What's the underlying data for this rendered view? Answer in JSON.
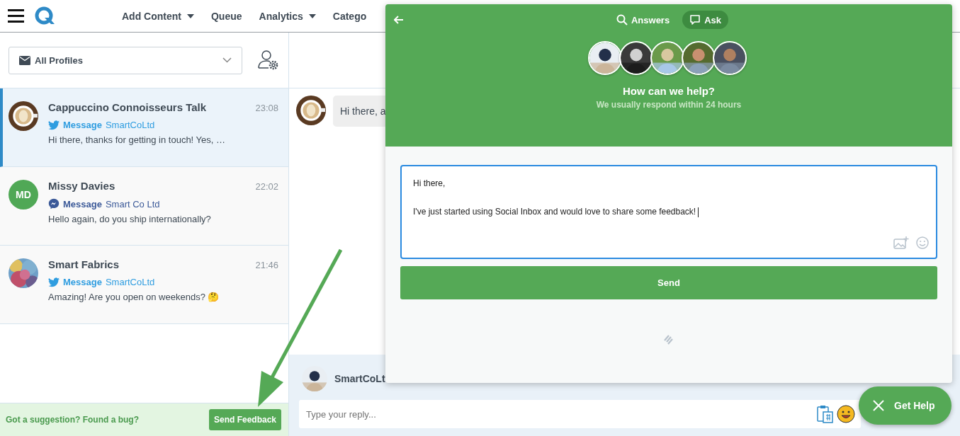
{
  "nav": {
    "items": [
      {
        "label": "Add Content",
        "dropdown": true
      },
      {
        "label": "Queue",
        "dropdown": false
      },
      {
        "label": "Analytics",
        "dropdown": true
      },
      {
        "label": "Catego",
        "dropdown": false
      }
    ]
  },
  "sidebar": {
    "profile_filter": "All Profiles",
    "conversations": [
      {
        "name": "Cappuccino Connoisseurs Talk",
        "time": "23:08",
        "kind": "twitter",
        "type": "Message",
        "account": "SmartCoLtd",
        "preview": "Hi there, thanks for getting in touch! Yes, …",
        "selected": true
      },
      {
        "name": "Missy Davies",
        "time": "22:02",
        "kind": "messenger",
        "type": "Message",
        "account": "Smart Co Ltd",
        "preview": "Hello again, do you ship internationally?",
        "avatar": {
          "kind": "initials",
          "initials": "MD"
        },
        "selected": false
      },
      {
        "name": "Smart Fabrics",
        "time": "21:46",
        "kind": "twitter",
        "type": "Message",
        "account": "SmartCoLtd",
        "preview": "Amazing! Are you open on weekends? 🤔",
        "selected": false
      }
    ],
    "footer": {
      "prompt": "Got a suggestion? Found a bug?",
      "button": "Send Feedback"
    }
  },
  "conversation": {
    "message": "Hi there, a",
    "reply_author": "SmartCoLt",
    "reply_placeholder": "Type your reply..."
  },
  "help_widget": {
    "tabs": [
      {
        "label": "Answers",
        "selected": false
      },
      {
        "label": "Ask",
        "selected": true
      }
    ],
    "title": "How can we help?",
    "subtitle": "We usually respond within 24 hours",
    "message": "Hi there,\n\nI've just started using Social Inbox and would love to share some feedback!",
    "send_button": "Send"
  },
  "get_help": {
    "label": "Get Help"
  }
}
